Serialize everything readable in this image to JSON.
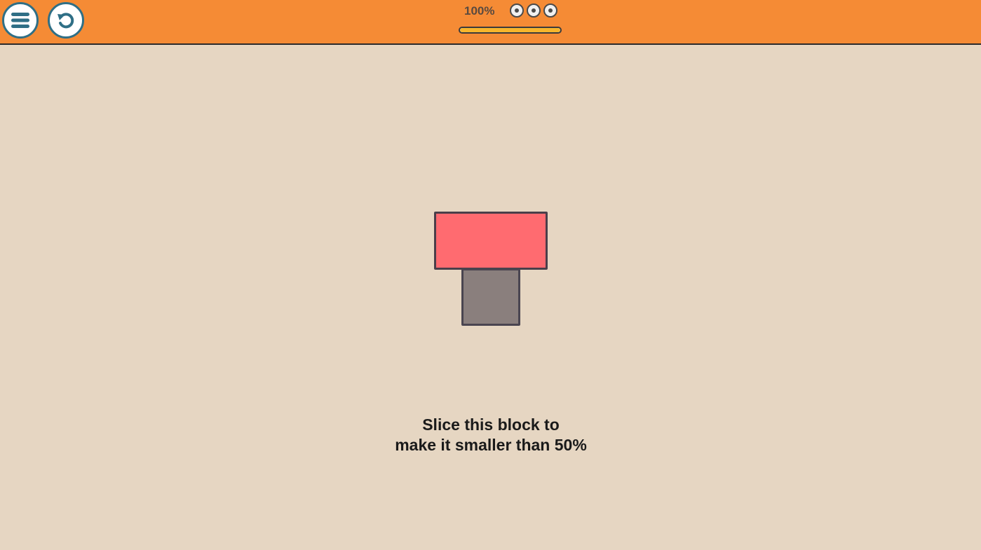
{
  "topbar": {
    "menu_icon": "hamburger-menu-icon",
    "restart_icon": "restart-icon",
    "percent": "100%",
    "stars": {
      "icon": "target-circle-icon",
      "count": 3
    },
    "progress_fraction": 1.0
  },
  "game": {
    "blocks": [
      {
        "name": "red-block",
        "color": "#ff6b70"
      },
      {
        "name": "gray-block",
        "color": "#8a7f7d"
      }
    ],
    "instruction": {
      "line1": "Slice this block to",
      "line2": "make it smaller than 50%"
    }
  },
  "colors": {
    "topbar": "#f58b35",
    "background": "#e6d6c2",
    "button_border": "#2f6f86",
    "progress_fill": "#f7b52c"
  }
}
